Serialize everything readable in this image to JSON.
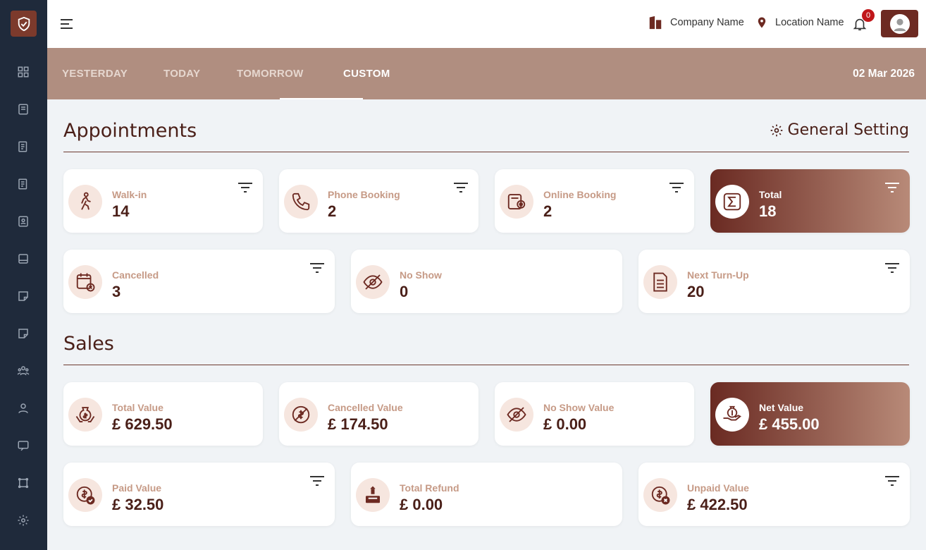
{
  "header": {
    "company": "Company Name",
    "location": "Location Name",
    "notification_count": "0"
  },
  "tabs": [
    {
      "label": "YESTERDAY",
      "active": false
    },
    {
      "label": "TODAY",
      "active": false
    },
    {
      "label": "TOMORROW",
      "active": false
    },
    {
      "label": "CUSTOM",
      "active": true
    }
  ],
  "date": "02 Mar 2026",
  "appointments": {
    "title": "Appointments",
    "settings_label": "General Setting",
    "cards": [
      {
        "label": "Walk-in",
        "value": "14",
        "icon": "walking-person-icon"
      },
      {
        "label": "Phone Booking",
        "value": "2",
        "icon": "phone-icon"
      },
      {
        "label": "Online Booking",
        "value": "2",
        "icon": "online-booking-icon"
      },
      {
        "label": "Total",
        "value": "18",
        "icon": "sigma-icon"
      },
      {
        "label": "Cancelled",
        "value": "3",
        "icon": "calendar-cancel-icon"
      },
      {
        "label": "No Show",
        "value": "0",
        "icon": "eye-off-icon"
      },
      {
        "label": "Next Turn-Up",
        "value": "20",
        "icon": "document-icon"
      }
    ]
  },
  "sales": {
    "title": "Sales",
    "cards": [
      {
        "label": "Total Value",
        "value": "£ 629.50",
        "icon": "money-hands-icon"
      },
      {
        "label": "Cancelled Value",
        "value": "£ 174.50",
        "icon": "money-cancel-icon"
      },
      {
        "label": "No Show Value",
        "value": "£ 0.00",
        "icon": "eye-off-icon"
      },
      {
        "label": "Net Value",
        "value": "£ 455.00",
        "icon": "money-bag-hand-icon"
      },
      {
        "label": "Paid Value",
        "value": "£ 32.50",
        "icon": "dollar-check-icon"
      },
      {
        "label": "Total Refund",
        "value": "£ 0.00",
        "icon": "refund-icon"
      },
      {
        "label": "Unpaid Value",
        "value": "£ 422.50",
        "icon": "dollar-cancel-icon"
      }
    ]
  },
  "colors": {
    "sidebar": "#1f2a3b",
    "brand": "#6d2a22",
    "tabs_bar": "#b08e80",
    "label": "#c69a86",
    "value": "#4a1f18"
  }
}
